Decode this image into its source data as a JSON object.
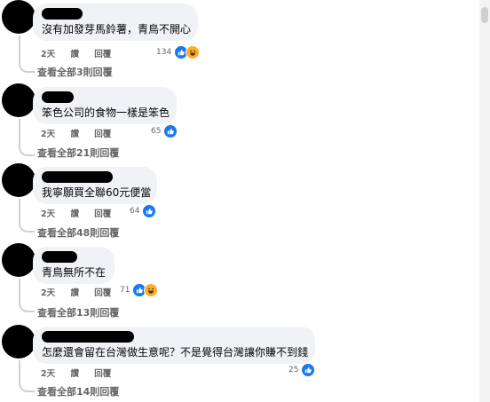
{
  "comments": [
    {
      "text": "沒有加發芽馬鈴薯，青鳥不開心",
      "time": "2天",
      "like": "讚",
      "reply": "回覆",
      "reaction_count": "134",
      "reactions": [
        "like-icon",
        "haha-icon"
      ],
      "view_replies": "查看全部3則回覆"
    },
    {
      "text": "笨色公司的食物一樣是笨色",
      "time": "2天",
      "like": "讚",
      "reply": "回覆",
      "reaction_count": "65",
      "reactions": [
        "like-icon"
      ],
      "view_replies": "查看全部21則回覆"
    },
    {
      "text": "我寧願買全聯60元便當",
      "time": "2天",
      "like": "讚",
      "reply": "回覆",
      "reaction_count": "64",
      "reactions": [
        "like-icon"
      ],
      "view_replies": "查看全部48則回覆"
    },
    {
      "text": "青鳥無所不在",
      "time": "2天",
      "like": "讚",
      "reply": "回覆",
      "reaction_count": "71",
      "reactions": [
        "like-icon",
        "haha-icon"
      ],
      "view_replies": "查看全部13則回覆"
    },
    {
      "text": "怎麼還會留在台灣做生意呢？不是覺得台灣讓你賺不到錢",
      "time": "2天",
      "like": "讚",
      "reply": "回覆",
      "reaction_count": "25",
      "reactions": [
        "like-icon"
      ],
      "view_replies": "查看全部14則回覆"
    }
  ],
  "colors": {
    "bubble": "#f0f2f5",
    "meta_text": "#65676b",
    "like_blue": "#1877f2",
    "haha_yellow": "#f7b125"
  }
}
